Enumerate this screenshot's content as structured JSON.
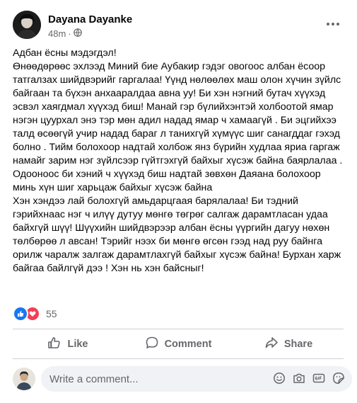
{
  "post": {
    "author": "Dayana Dayanke",
    "time": "48m",
    "separator": "·",
    "privacy_icon": "public-globe-icon",
    "paragraphs": [
      "Адбан ёсны мэдэгдэл!\nӨнөөдөрөөс эхлээд Миний бие Аубакир  гэдэг  овогоос албан ёсоор татгалзах шийдвэрийг гаргалаа! Үүнд нөлөөлөх маш олон хүчин зүйлс байгаан та бүхэн анхааралдаа авна уу! Би хэн нэгний бутач хүүхэд эсвэл хаягдмал хүүхэд биш! Манай гэр бүлийхэнтэй холбоотой ямар нэгэн цуурхал энэ тэр мөн адил надад ямар ч хамаагүй . Би эцгийхээ талд өсөөгүй учир надад бараг л танихгүй хүмүүс шиг санагддаг гэхэд болно . Тийм болохоор надтай  холбож янз бүрийн худлаа яриа гаргаж намайг зарим нэг зүйлсээр гүйтгэхгүй байхыг хүсэж  байна баярлалаа . Одооноос би хэний ч хүүхэд биш надтай зөвхөн Даяана болохоор минь хүн шиг харьцаж байхыг хүсэж байна",
      "Хэн хэндээ лай болохгүй амьдарцгаая барялалаа! Би тэдний гэрийхнаас нэг ч илүү дутуу мөнгө төгрөг салгаж дарамтласан удаа байхгүй шүү! Шүүхийн шийдвэрээр албан  ёсны үүргийн дагуу нөхөн төлбөрөө л авсан! Тэрийг нээх би мөнгө өгсөн гээд над руу байнга орилж чаралж залгаж дарамтлахгүй байхыг хүсэж байна! Бурхан харж байгаа байлгүй дээ ! Хэн нь хэн байсныг!"
    ]
  },
  "reactions": {
    "count": "55",
    "icons": [
      "like-icon",
      "love-icon"
    ]
  },
  "actions": {
    "like_label": "Like",
    "comment_label": "Comment",
    "share_label": "Share"
  },
  "comment": {
    "placeholder": "Write a comment...",
    "icons": [
      "emoji-icon",
      "camera-icon",
      "gif-icon",
      "sticker-icon"
    ]
  },
  "colors": {
    "like_blue": "#1877f2",
    "love_red": "#f33e58",
    "secondary_text": "#65676b",
    "input_bg": "#f0f2f5"
  }
}
